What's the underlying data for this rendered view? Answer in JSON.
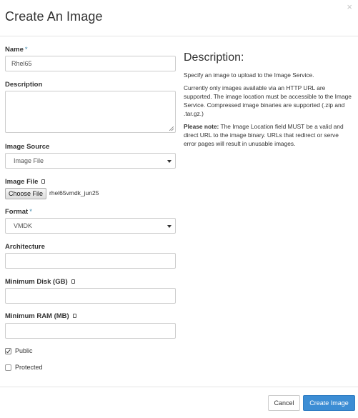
{
  "modal": {
    "title": "Create An Image",
    "close_glyph": "×"
  },
  "form": {
    "name": {
      "label": "Name",
      "required_mark": "*",
      "value": "Rhel65"
    },
    "description": {
      "label": "Description",
      "value": ""
    },
    "image_source": {
      "label": "Image Source",
      "selected": "Image File"
    },
    "image_file": {
      "label": "Image File",
      "button_label": "Choose File",
      "file_name": "rhel65vmdk_jun25"
    },
    "format": {
      "label": "Format",
      "required_mark": "*",
      "selected": "VMDK"
    },
    "architecture": {
      "label": "Architecture",
      "value": ""
    },
    "min_disk": {
      "label": "Minimum Disk (GB)",
      "value": ""
    },
    "min_ram": {
      "label": "Minimum RAM (MB)",
      "value": ""
    },
    "public": {
      "label": "Public",
      "checked": true
    },
    "protected": {
      "label": "Protected",
      "checked": false
    }
  },
  "description_panel": {
    "title": "Description:",
    "p1": "Specify an image to upload to the Image Service.",
    "p2": "Currently only images available via an HTTP URL are supported. The image location must be accessible to the Image Service. Compressed image binaries are supported (.zip and .tar.gz.)",
    "note_label": "Please note:",
    "note_text": " The Image Location field MUST be a valid and direct URL to the image binary. URLs that redirect or serve error pages will result in unusable images."
  },
  "footer": {
    "cancel_label": "Cancel",
    "create_label": "Create Image"
  },
  "icons": {
    "help": "help-icon",
    "close": "close-icon",
    "caret": "caret-down-icon",
    "check": "check-icon"
  },
  "colors": {
    "primary": "#3c8dd4",
    "required": "#3a87ad",
    "border": "#cccccc"
  }
}
